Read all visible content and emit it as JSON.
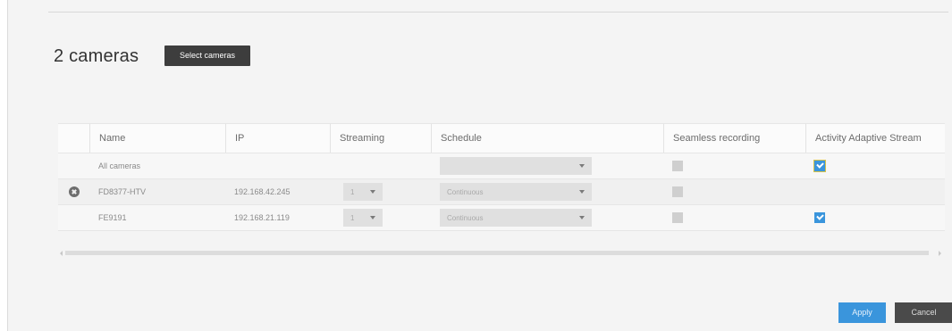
{
  "header": {
    "count_title": "2 cameras",
    "select_cameras_label": "Select cameras"
  },
  "table": {
    "columns": {
      "name": "Name",
      "ip": "IP",
      "streaming": "Streaming",
      "schedule": "Schedule",
      "seamless": "Seamless recording",
      "activity": "Activity Adaptive Stream"
    },
    "all_row": {
      "name": "All cameras",
      "schedule": "",
      "seamless_checked": false,
      "activity_checked": true
    },
    "rows": [
      {
        "name": "FD8377-HTV",
        "ip": "192.168.42.245",
        "streaming": "1",
        "schedule": "Continuous",
        "seamless_checked": false,
        "activity_checked": false
      },
      {
        "name": "FE9191",
        "ip": "192.168.21.119",
        "streaming": "1",
        "schedule": "Continuous",
        "seamless_checked": false,
        "activity_checked": true
      }
    ]
  },
  "footer": {
    "apply_label": "Apply",
    "cancel_label": "Cancel"
  },
  "colors": {
    "accent": "#3a95dc",
    "dark_button": "#4a4a4a",
    "panel_background": "#f4f4f4"
  },
  "icons": {
    "remove": "remove-icon",
    "dropdown": "chevron-down-icon",
    "checkbox": "checkbox-icon"
  }
}
